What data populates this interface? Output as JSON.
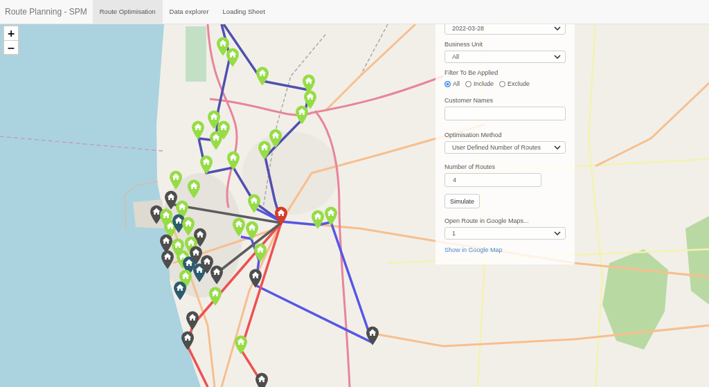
{
  "app_title": "Route Planning - SPM",
  "tabs": [
    {
      "label": "Route Optimisation",
      "selected": true
    },
    {
      "label": "Data explorer",
      "selected": false
    },
    {
      "label": "Loading Sheet",
      "selected": false
    }
  ],
  "map": {
    "zoom_controls": [
      "+",
      "−"
    ],
    "routes": [
      {
        "color": "#5050b0"
      },
      {
        "color": "#5656e6"
      },
      {
        "color": "#ef5050"
      },
      {
        "color": "#5c5c5c"
      }
    ],
    "markers": [
      {
        "color": "#96dc46"
      },
      {
        "color": "#96dc46"
      },
      {
        "color": "#96dc46"
      },
      {
        "color": "#96dc46"
      },
      {
        "color": "#96dc46"
      },
      {
        "color": "#96dc46"
      },
      {
        "color": "#96dc46"
      },
      {
        "color": "#96dc46"
      },
      {
        "color": "#96dc46"
      },
      {
        "color": "#96dc46"
      },
      {
        "color": "#96dc46"
      },
      {
        "color": "#96dc46"
      },
      {
        "color": "#96dc46"
      },
      {
        "color": "#96dc46"
      },
      {
        "color": "#96dc46"
      },
      {
        "color": "#96dc46"
      },
      {
        "color": "#4d4d4d"
      },
      {
        "color": "#96dc46"
      },
      {
        "color": "#d33d29"
      },
      {
        "color": "#96dc46"
      },
      {
        "color": "#96dc46"
      },
      {
        "color": "#4d4d4d"
      },
      {
        "color": "#96dc46"
      },
      {
        "color": "#96dc46"
      },
      {
        "color": "#96dc46"
      },
      {
        "color": "#2e5b6e"
      },
      {
        "color": "#96dc46"
      },
      {
        "color": "#96dc46"
      },
      {
        "color": "#96dc46"
      },
      {
        "color": "#4d4d4d"
      },
      {
        "color": "#4d4d4d"
      },
      {
        "color": "#96dc46"
      },
      {
        "color": "#96dc46"
      },
      {
        "color": "#4d4d4d"
      },
      {
        "color": "#4d4d4d"
      },
      {
        "color": "#96dc46"
      },
      {
        "color": "#96dc46"
      },
      {
        "color": "#2e5b6e"
      },
      {
        "color": "#2e5b6e"
      },
      {
        "color": "#4d4d4d"
      },
      {
        "color": "#4d4d4d"
      },
      {
        "color": "#96dc46"
      },
      {
        "color": "#4d4d4d"
      },
      {
        "color": "#2e5b6e"
      },
      {
        "color": "#96dc46"
      },
      {
        "color": "#4d4d4d"
      },
      {
        "color": "#4d4d4d"
      },
      {
        "color": "#4d4d4d"
      },
      {
        "color": "#96dc46"
      },
      {
        "color": "#4d4d4d"
      }
    ]
  },
  "panel": {
    "controls": [
      {
        "kind": "select",
        "value": "2022-03-28"
      },
      {
        "kind": "select",
        "label": "Business Unit",
        "value": "All"
      },
      {
        "kind": "radio",
        "label": "Filter To Be Applied",
        "options": [
          {
            "label": "All",
            "selected": true
          },
          {
            "label": "Include",
            "selected": false
          },
          {
            "label": "Exclude",
            "selected": false
          }
        ]
      },
      {
        "kind": "input",
        "label": "Customer Names"
      },
      {
        "kind": "select",
        "label": "Optimisation Method",
        "value": "User Defined Number of Routes"
      },
      {
        "kind": "input",
        "label": "Number of Routes",
        "value": "4"
      },
      {
        "kind": "button",
        "label": "Simulate"
      },
      {
        "kind": "select",
        "label": "Open Route in Google Maps...",
        "value": "1"
      },
      {
        "kind": "link",
        "label": "Show in Google Map"
      }
    ]
  }
}
